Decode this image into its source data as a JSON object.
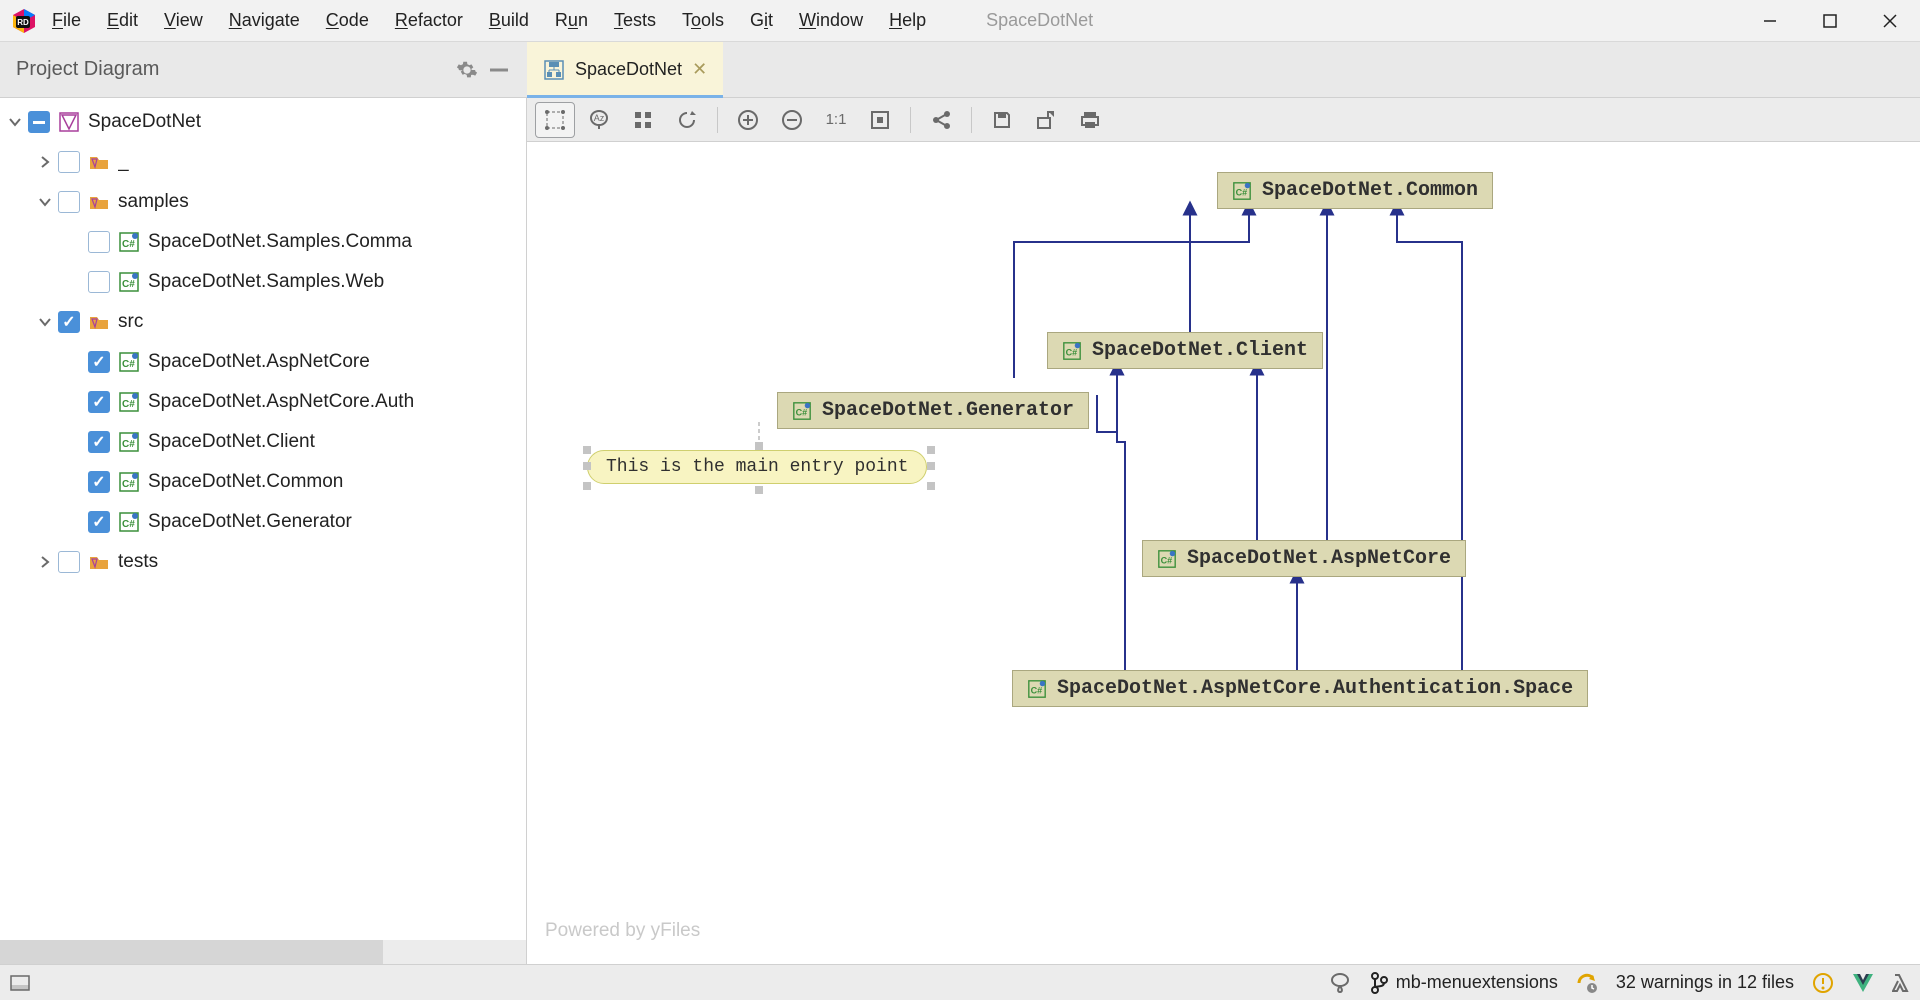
{
  "app": {
    "title": "SpaceDotNet"
  },
  "menu": {
    "file": "File",
    "edit": "Edit",
    "view": "View",
    "navigate": "Navigate",
    "code": "Code",
    "refactor": "Refactor",
    "build": "Build",
    "run": "Run",
    "tests": "Tests",
    "tools": "Tools",
    "git": "Git",
    "window": "Window",
    "help": "Help"
  },
  "panel": {
    "title": "Project Diagram"
  },
  "tab": {
    "label": "SpaceDotNet"
  },
  "tree": {
    "root": {
      "label": "SpaceDotNet"
    },
    "underscore": {
      "label": "_"
    },
    "samples": {
      "label": "samples"
    },
    "samples_common": {
      "label": "SpaceDotNet.Samples.Comma"
    },
    "samples_web": {
      "label": "SpaceDotNet.Samples.Web"
    },
    "src": {
      "label": "src"
    },
    "aspnetcore": {
      "label": "SpaceDotNet.AspNetCore"
    },
    "aspnetcore_auth": {
      "label": "SpaceDotNet.AspNetCore.Auth"
    },
    "client": {
      "label": "SpaceDotNet.Client"
    },
    "common": {
      "label": "SpaceDotNet.Common"
    },
    "generator": {
      "label": "SpaceDotNet.Generator"
    },
    "tests": {
      "label": "tests"
    }
  },
  "diagram": {
    "powered": "Powered by yFiles",
    "note": "This is the main entry point",
    "nodes": {
      "common": "SpaceDotNet.Common",
      "client": "SpaceDotNet.Client",
      "generator": "SpaceDotNet.Generator",
      "aspnetcore": "SpaceDotNet.AspNetCore",
      "auth": "SpaceDotNet.AspNetCore.Authentication.Space"
    }
  },
  "status": {
    "branch": "mb-menuextensions",
    "warnings": "32 warnings in 12 files"
  }
}
